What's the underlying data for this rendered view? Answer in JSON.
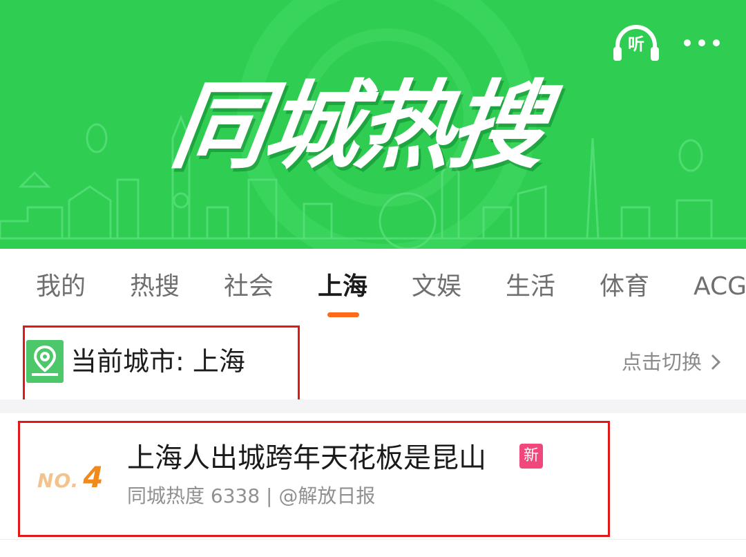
{
  "banner": {
    "title": "同城热搜",
    "listen_label": "听",
    "background_color": "#2fce52",
    "icons": [
      "headphones-icon",
      "more-dots-icon"
    ]
  },
  "tabs": {
    "items": [
      {
        "label": "我的",
        "active": false
      },
      {
        "label": "热搜",
        "active": false
      },
      {
        "label": "社会",
        "active": false
      },
      {
        "label": "上海",
        "active": true
      },
      {
        "label": "文娱",
        "active": false
      },
      {
        "label": "生活",
        "active": false
      },
      {
        "label": "体育",
        "active": false
      },
      {
        "label": "ACG",
        "active": false
      }
    ],
    "accent_color": "#ff6a1a"
  },
  "city": {
    "label": "当前城市: 上海",
    "switch_label": "点击切换",
    "icon": "location-pin-icon"
  },
  "hot_item": {
    "rank_prefix": "NO.",
    "rank": "4",
    "title": "上海人出城跨年天花板是昆山",
    "badge": "新",
    "meta": "同城热度 6338 | @解放日报"
  },
  "highlight_color": "#e01818"
}
